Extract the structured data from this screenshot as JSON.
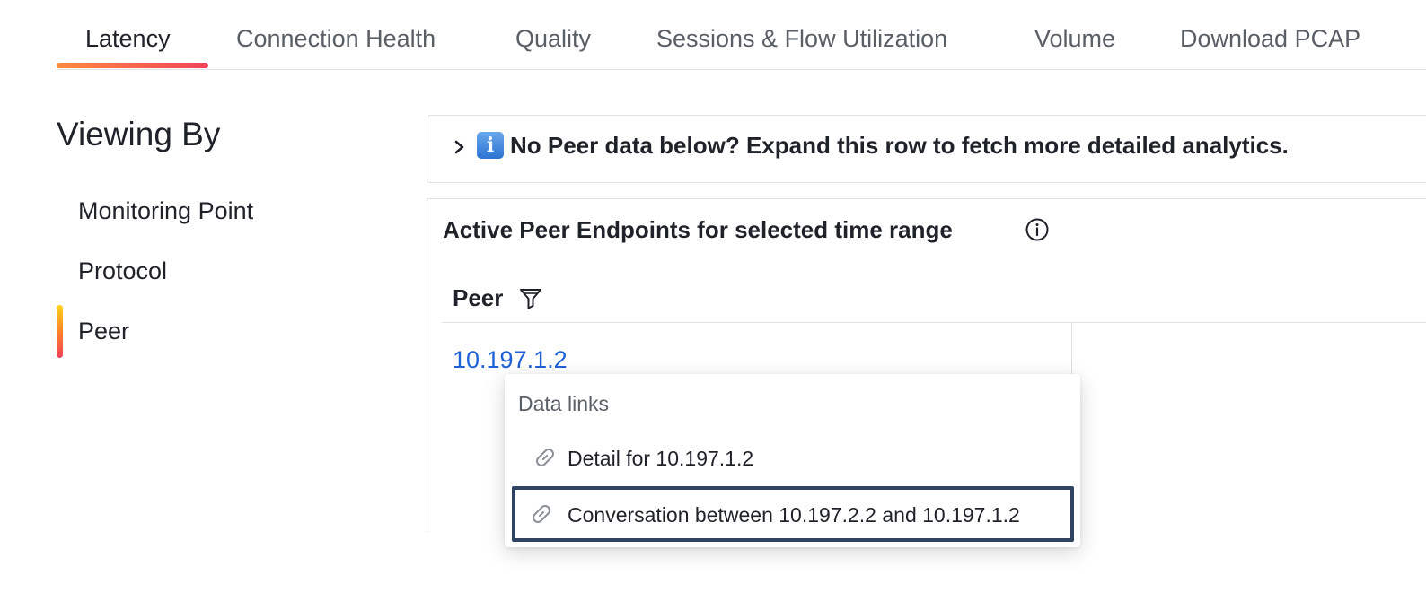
{
  "tabs": [
    {
      "label": "Latency",
      "active": true
    },
    {
      "label": "Connection Health",
      "active": false
    },
    {
      "label": "Quality",
      "active": false
    },
    {
      "label": "Sessions & Flow Utilization",
      "active": false
    },
    {
      "label": "Volume",
      "active": false
    },
    {
      "label": "Download PCAP",
      "active": false
    }
  ],
  "sidebar": {
    "title": "Viewing By",
    "items": [
      {
        "label": "Monitoring Point",
        "selected": false
      },
      {
        "label": "Protocol",
        "selected": false
      },
      {
        "label": "Peer",
        "selected": true
      }
    ]
  },
  "expand_row": {
    "icon": "information-emoji",
    "text": "No Peer data below? Expand this row to fetch more detailed analytics."
  },
  "endpoints": {
    "title": "Active Peer Endpoints for selected time range",
    "column_header": "Peer",
    "rows": [
      {
        "peer": "10.197.1.2"
      }
    ]
  },
  "data_links_popup": {
    "header": "Data links",
    "items": [
      {
        "label": "Detail for 10.197.1.2",
        "icon": "link-icon",
        "focused": false
      },
      {
        "label": "Conversation between 10.197.2.2 and 10.197.1.2",
        "icon": "link-icon",
        "focused": true
      }
    ]
  },
  "colors": {
    "accent_gradient_start": "#ff8a3d",
    "accent_gradient_end": "#f0435c",
    "link": "#1f62d6",
    "focus_border": "#2f4462"
  }
}
